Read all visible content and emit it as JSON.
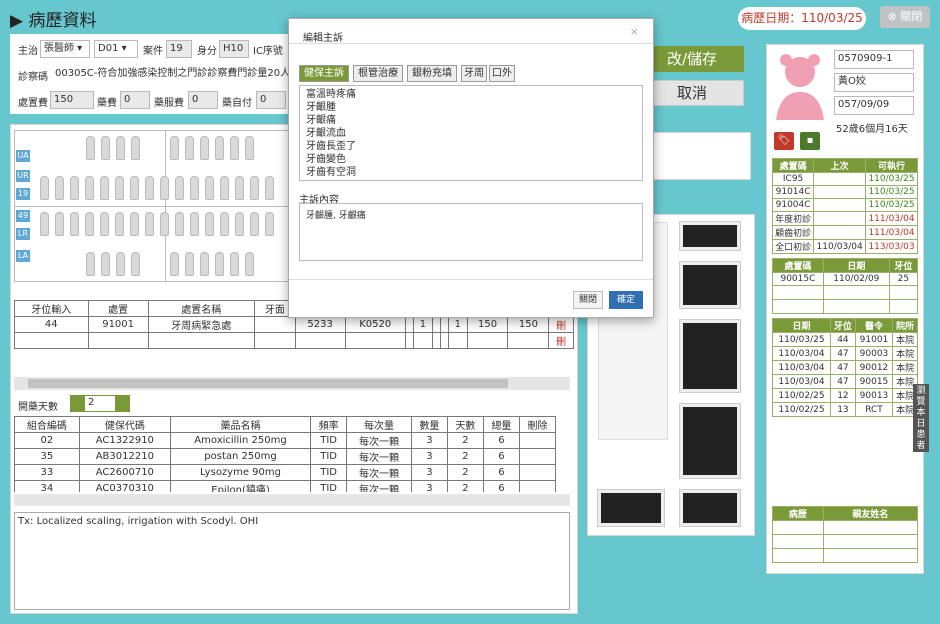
{
  "header": {
    "title": "病歷資料",
    "record_date_label": "病歷日期：110/03/25",
    "close_label": "關閉"
  },
  "form": {
    "doctor_label": "主治",
    "doctor": "張醫師",
    "dept": "D01",
    "case_label": "案件",
    "case": "19",
    "identity_label": "身分",
    "identity": "H10",
    "ic_label": "IC序號",
    "clinic_label": "診察碼",
    "clinic_value": "00305C-符合加強感染控制之門診診察費門診量20人",
    "fee1_label": "處置費",
    "fee1": "150",
    "fee2_label": "藥費",
    "fee2": "0",
    "fee3_label": "藥服費",
    "fee3": "0",
    "fee4_label": "藥自付",
    "fee4": "0"
  },
  "buttons": {
    "save": "改/儲存",
    "cancel": "取消"
  },
  "tooth_chart": {
    "tags": [
      "UA",
      "UR",
      "19",
      "49",
      "LR",
      "LA"
    ]
  },
  "proc_table": {
    "headers": [
      "牙位輸入",
      "處置",
      "處置名稱",
      "牙面",
      "ICD9",
      "ICD10",
      "",
      "",
      "",
      "",
      "1",
      "金額",
      "小計",
      "刪"
    ],
    "rows": [
      [
        "44",
        "91001",
        "牙周病緊急處",
        "",
        "5233",
        "K0520",
        "",
        "1",
        "",
        "",
        "1",
        "150",
        "150",
        "刪"
      ],
      [
        "",
        "",
        "",
        "",
        "",
        "",
        "",
        "",
        "",
        "",
        "",
        "",
        "",
        "刪"
      ]
    ]
  },
  "days": {
    "label": "開藥天數",
    "value": "2"
  },
  "drug_table": {
    "headers": [
      "組合編碼",
      "健保代碼",
      "藥品名稱",
      "頻率",
      "每次量",
      "數量",
      "天數",
      "總量",
      "刪除"
    ],
    "rows": [
      [
        "02",
        "AC1322910",
        "Amoxicillin 250mg",
        "TID",
        "每次一顆",
        "3",
        "2",
        "6",
        ""
      ],
      [
        "35",
        "AB3012210",
        "postan 250mg",
        "TID",
        "每次一顆",
        "3",
        "2",
        "6",
        ""
      ],
      [
        "33",
        "AC2600710",
        "Lysozyme 90mg",
        "TID",
        "每次一顆",
        "3",
        "2",
        "6",
        ""
      ],
      [
        "34",
        "AC0370310",
        "Epilon(鎮痛)",
        "TID",
        "每次一顆",
        "3",
        "2",
        "6",
        ""
      ]
    ]
  },
  "notes": "Tx: Localized scaling, irrigation with Scodyl. OHI",
  "patient": {
    "id": "0570909-1",
    "name": "黃O姣",
    "dob": "057/09/09",
    "age": "52歲6個月16天"
  },
  "rx_table": {
    "headers": [
      "處置碼",
      "上次",
      "可執行"
    ],
    "rows": [
      [
        "IC95",
        "",
        "110/03/25"
      ],
      [
        "91014C",
        "",
        "110/03/25"
      ],
      [
        "91004C",
        "",
        "110/03/25"
      ],
      [
        "年度初診",
        "",
        "111/03/04"
      ],
      [
        "顧齒初診",
        "",
        "111/03/04"
      ],
      [
        "全口初診",
        "110/03/04",
        "113/03/03"
      ]
    ]
  },
  "tooth_hist": {
    "headers": [
      "處置碼",
      "日期",
      "牙位"
    ],
    "rows": [
      [
        "90015C",
        "110/02/09",
        "25"
      ]
    ]
  },
  "visit_table": {
    "headers": [
      "日期",
      "牙位",
      "醫令",
      "院所"
    ],
    "rows": [
      [
        "110/03/25",
        "44",
        "91001",
        "本院"
      ],
      [
        "110/03/04",
        "47",
        "90003",
        "本院"
      ],
      [
        "110/03/04",
        "47",
        "90012",
        "本院"
      ],
      [
        "110/03/04",
        "47",
        "90015",
        "本院"
      ],
      [
        "110/02/25",
        "12",
        "90013",
        "本院"
      ],
      [
        "110/02/25",
        "13",
        "RCT",
        "本院"
      ]
    ]
  },
  "history_table": {
    "headers": [
      "病歷",
      "親友姓名"
    ]
  },
  "side_tab": "瀏覽本日患者",
  "modal": {
    "title": "編輯主訴",
    "tabs": [
      "健保主訴",
      "根管治療",
      "銀粉充填",
      "牙周",
      "口外"
    ],
    "complaints": [
      "富溫時疼痛",
      "牙齦腫",
      "牙齦痛",
      "牙齦流血",
      "牙齒長歪了",
      "牙齒變色",
      "牙齒有空洞"
    ],
    "content_label": "主訴內容",
    "content": "牙齦腫, 牙齦痛",
    "close": "關閉",
    "ok": "確定"
  },
  "colors": {
    "bg": "#67c7cf",
    "green": "#7a9a3a",
    "red": "#c0392b",
    "pink": "#f1a0b4"
  }
}
